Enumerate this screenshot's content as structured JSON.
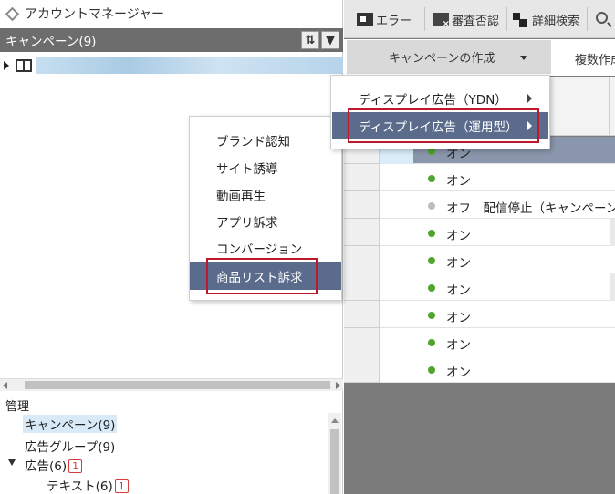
{
  "app": {
    "title": "アカウントマネージャー"
  },
  "campaign_panel": {
    "header_label": "キャンペーン(9)",
    "sort_icon": "sort-icon",
    "filter_icon": "filter-icon"
  },
  "manage": {
    "title": "管理",
    "items": [
      {
        "label": "キャンペーン(9)"
      },
      {
        "label": "広告グループ(9)"
      },
      {
        "label": "広告(6)",
        "badge": "1"
      },
      {
        "label": "テキスト(6)",
        "badge": "1"
      }
    ]
  },
  "toolbar": {
    "errors": "エラー",
    "review": "審査否認",
    "details": "詳細検索"
  },
  "actions": {
    "create_campaign": "キャンペーンの作成",
    "multi_create": "複数作成"
  },
  "create_menu": {
    "items": [
      {
        "label": "ディスプレイ広告（YDN）"
      },
      {
        "label": "ディスプレイ広告（運用型）"
      }
    ]
  },
  "objective_menu": {
    "items": [
      {
        "label": "ブランド認知"
      },
      {
        "label": "サイト誘導"
      },
      {
        "label": "動画再生"
      },
      {
        "label": "アプリ訴求"
      },
      {
        "label": "コンバージョン"
      },
      {
        "label": "商品リスト訴求"
      }
    ]
  },
  "grid": {
    "rows": [
      {
        "status": "オン"
      },
      {
        "status": "オン"
      },
      {
        "status": "オフ　配信停止（キャンペーン"
      },
      {
        "status": "オン"
      },
      {
        "status": "オン"
      },
      {
        "status": "オン"
      },
      {
        "status": "オン"
      },
      {
        "status": "オン"
      },
      {
        "status": "オン"
      }
    ]
  },
  "colors": {
    "menu_highlight": "#5b6b8b",
    "callout_red": "#c0182b",
    "status_on": "#4fa52e",
    "status_off": "#bdbdbd"
  }
}
